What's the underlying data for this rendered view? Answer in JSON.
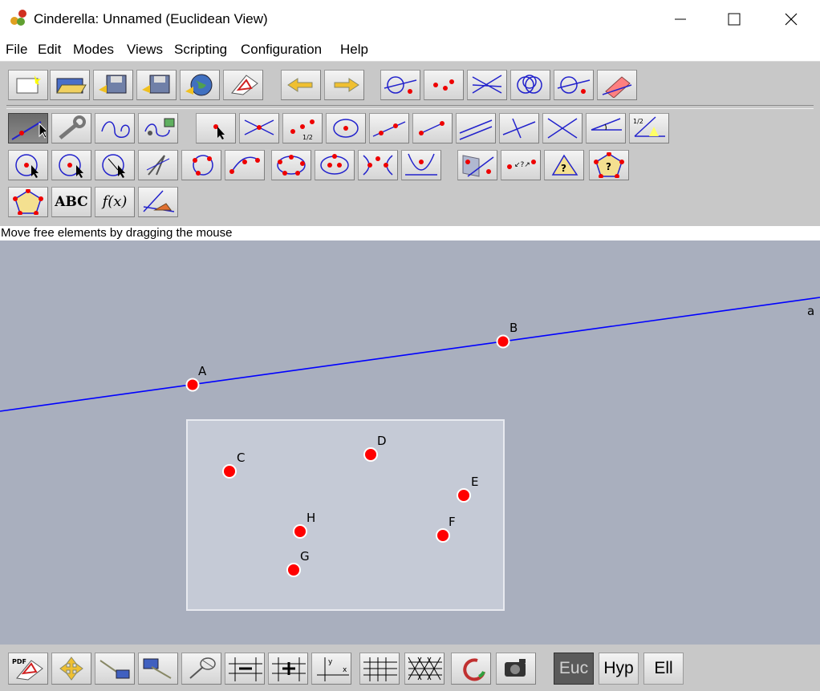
{
  "window": {
    "title": "Cinderella: Unnamed (Euclidean View)"
  },
  "menu": [
    "File",
    "Edit",
    "Modes",
    "Views",
    "Scripting",
    "Configuration",
    "Help"
  ],
  "status": {
    "message": "Move free elements by dragging the mouse"
  },
  "toolbar": {
    "file_row": [
      "new-file-icon",
      "open-file-icon",
      "save-file-icon",
      "save-as-icon",
      "export-web-icon",
      "print-icon",
      "undo-icon",
      "redo-icon",
      "redraw-icon",
      "show-points-icon",
      "show-lines-icon",
      "show-circles-icon",
      "show-conics-icon",
      "eraser-icon"
    ],
    "mode_row_1": [
      "move-mode-icon",
      "wrench-icon",
      "free-curve-icon",
      "animation-icon",
      "add-point-icon",
      "intersection-icon",
      "midpoint-icon",
      "circle-by-center-icon",
      "line-through-two-points-icon",
      "segment-icon",
      "parallel-icon",
      "perpendicular-icon",
      "line-through-point-icon",
      "angle-bisector-icon",
      "angle-half-icon"
    ],
    "mode_row_2": [
      "circle-by-radius-icon",
      "compass-icon",
      "circle-by-three-points-icon",
      "compass-tool-icon",
      "conic-by-five-points-icon",
      "arc-icon",
      "polygon-points-icon",
      "ellipse-icon",
      "hyperbola-icon",
      "parabola-icon",
      "mirror-icon",
      "transformation-icon",
      "check-triangle-icon",
      "check-polygon-icon"
    ],
    "mode_row_3": [
      "polygon-icon",
      "text-icon",
      "function-icon",
      "measure-angle-icon"
    ],
    "text_button": "ABC",
    "function_button": "f(x)"
  },
  "canvas": {
    "line_label": "a",
    "points": [
      {
        "name": "A"
      },
      {
        "name": "B"
      },
      {
        "name": "C"
      },
      {
        "name": "D"
      },
      {
        "name": "E"
      },
      {
        "name": "F"
      },
      {
        "name": "G"
      },
      {
        "name": "H"
      }
    ],
    "colors": {
      "background": "#a9afbe",
      "line": "#0000ff",
      "point": "#ff0000",
      "selection": "#c5cad6"
    }
  },
  "bottom_bar": {
    "tools": [
      "pdf-export-icon",
      "move-view-icon",
      "zoom-in-icon",
      "zoom-out-icon",
      "select-icon",
      "grid-coarser-icon",
      "grid-finer-icon",
      "axes-icon",
      "rect-grid-icon",
      "tri-grid-icon",
      "rotate-icon",
      "snapshot-icon"
    ],
    "geometry": [
      {
        "label": "Euc",
        "active": true
      },
      {
        "label": "Hyp",
        "active": false
      },
      {
        "label": "Ell",
        "active": false
      }
    ]
  }
}
